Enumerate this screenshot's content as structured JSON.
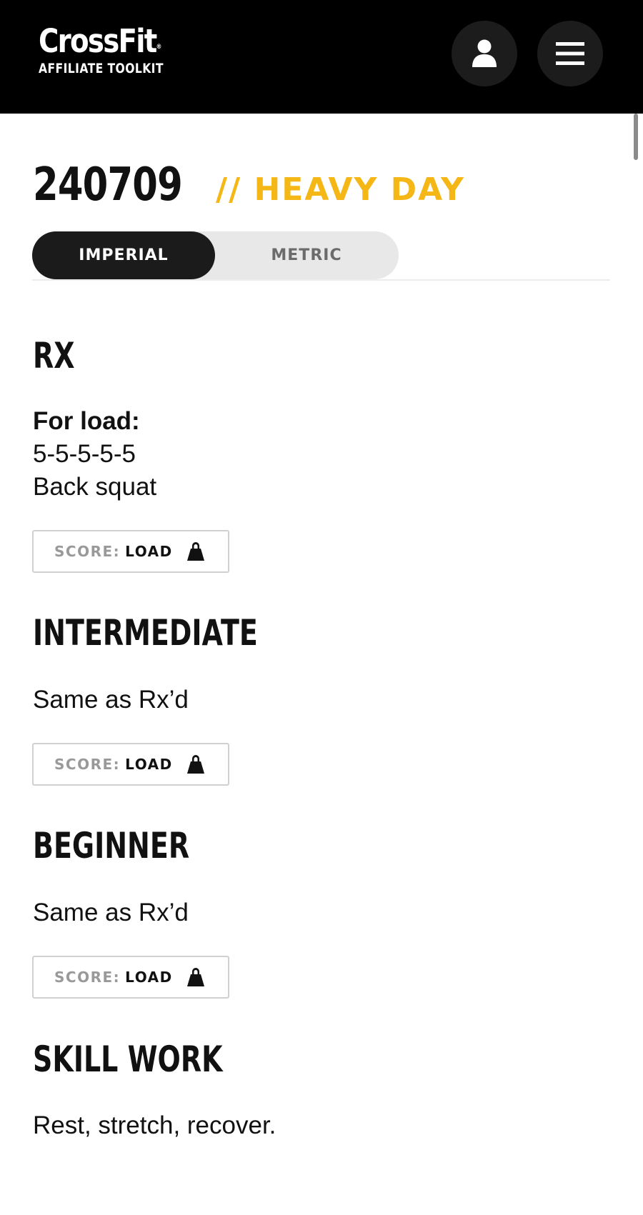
{
  "header": {
    "brand": "CrossFit",
    "brand_mark": "®",
    "subtitle": "AFFILIATE TOOLKIT",
    "icons": {
      "account": "user-icon",
      "menu": "hamburger-menu-icon"
    }
  },
  "workout": {
    "id": "240709",
    "tag": "// HEAVY DAY"
  },
  "units_toggle": {
    "options": [
      "IMPERIAL",
      "METRIC"
    ],
    "selected": "IMPERIAL"
  },
  "sections": [
    {
      "heading": "RX",
      "lines": [
        "For load:",
        "5-5-5-5-5",
        "Back squat"
      ],
      "score_label": "SCORE:",
      "score_value": "LOAD"
    },
    {
      "heading": "INTERMEDIATE",
      "lines": [
        "Same as Rx’d"
      ],
      "score_label": "SCORE:",
      "score_value": "LOAD"
    },
    {
      "heading": "BEGINNER",
      "lines": [
        "Same as Rx’d"
      ],
      "score_label": "SCORE:",
      "score_value": "LOAD"
    },
    {
      "heading": "SKILL WORK",
      "lines": [
        "Rest, stretch, recover."
      ]
    }
  ],
  "colors": {
    "header_bg": "#000000",
    "accent": "#f5b716",
    "toggle_active": "#1b1b1b",
    "toggle_bg": "#e8e8e8"
  }
}
